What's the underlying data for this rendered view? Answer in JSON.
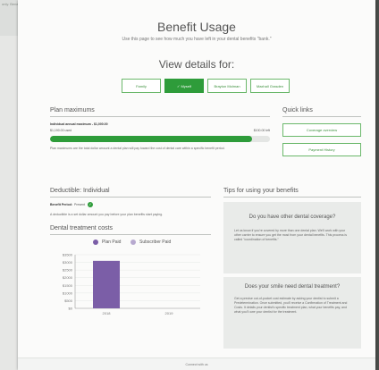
{
  "breadcrumb": "only. Benefits Coverage Payment History",
  "page": {
    "title": "Benefit Usage",
    "subtitle": "Use this page to see how much you have left in your dental benefits \"bank.\"",
    "view_title": "View details for:"
  },
  "members": [
    {
      "label": "Family",
      "active": false
    },
    {
      "label": "✓ Myself",
      "active": true
    },
    {
      "label": "Brayton Molman",
      "active": false
    },
    {
      "label": "Maxhall Grasden",
      "active": false
    }
  ],
  "plan_max": {
    "heading": "Plan maximums",
    "line_label": "Individual annual maximum - $1,000.00",
    "used": "$1,190.00 used",
    "remaining": "$100.00 left",
    "used_fraction": 0.92,
    "description": "Plan maximums are the total dollar amount a dental plan will pay toward the cost of dental care within a specific benefit period."
  },
  "quick_links": {
    "heading": "Quick links",
    "items": [
      "Coverage overview",
      "Payment History"
    ]
  },
  "deductible": {
    "heading": "Deductible: Individual",
    "period_label": "Benefit Period:",
    "period_value": "Present",
    "description": "A deductible is a set dollar amount you pay before your plan benefits start paying."
  },
  "treatment": {
    "heading": "Dental treatment costs",
    "legend": [
      "Plan Paid",
      "Subscriber Paid"
    ]
  },
  "tips": {
    "heading": "Tips for using your benefits",
    "items": [
      {
        "title": "Do you have other dental coverage?",
        "body": "Let us know if you're covered by more than one dental plan. We'll work with your other carrier to ensure you get the most from your dental benefits. This process is called \"coordination of benefits.\""
      },
      {
        "title": "Does your smile need dental treatment?",
        "body": "Get a precise out-of-pocket cost estimate by asking your dentist to submit a Predetermination. Once submitted, you'll receive a Confirmation of Treatment and Costs. It details your dentist's specific treatment plan, what your benefits pay, and what you'll owe your dentist for the treatment."
      }
    ]
  },
  "footer": {
    "text": "Connect with us"
  },
  "colors": {
    "accent": "#2e9c3a",
    "plan_paid": "#7b5ea7",
    "subscriber_paid": "#b7a9cf"
  },
  "chart_data": {
    "type": "bar",
    "categories": [
      "2018",
      "2019"
    ],
    "series": [
      {
        "name": "Plan Paid",
        "values": [
          3100,
          0
        ]
      },
      {
        "name": "Subscriber Paid",
        "values": [
          0,
          0
        ]
      }
    ],
    "yticks": [
      "$3500",
      "$3000",
      "$2500",
      "$2000",
      "$1500",
      "$1000",
      "$500",
      "$0"
    ],
    "ylim": [
      0,
      3500
    ]
  }
}
